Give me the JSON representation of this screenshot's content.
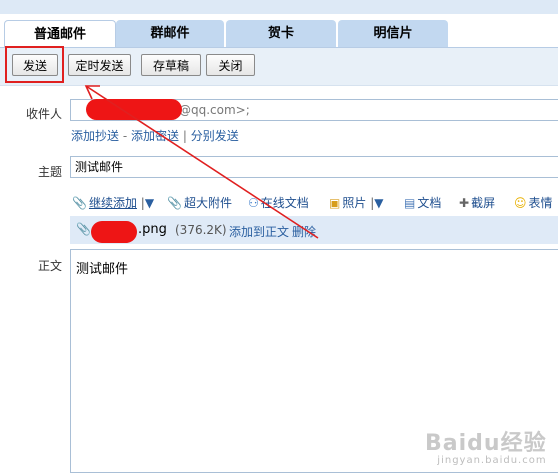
{
  "tabs": [
    "普通邮件",
    "群邮件",
    "贺卡",
    "明信片"
  ],
  "toolbar": {
    "send": "发送",
    "scheduled_send": "定时发送",
    "save_draft": "存草稿",
    "close": "关闭"
  },
  "recipient": {
    "label": "收件人",
    "value_suffix": "@qq.com>;",
    "actions": [
      "添加抄送",
      "-",
      "添加密送",
      "|",
      "分别发送"
    ]
  },
  "subject": {
    "label": "主题",
    "value": "测试邮件"
  },
  "attach_toolbar": {
    "items": [
      {
        "icon": "paperclip-icon",
        "label": "继续添加",
        "dropdown": true
      },
      {
        "icon": "paperclip-icon",
        "label": "超大附件"
      },
      {
        "icon": "online-doc-icon",
        "label": "在线文档"
      },
      {
        "icon": "photo-icon",
        "label": "照片",
        "dropdown": true
      },
      {
        "icon": "document-icon",
        "label": "文档"
      },
      {
        "icon": "screenshot-icon",
        "label": "截屏"
      },
      {
        "icon": "emoji-icon",
        "label": "表情"
      }
    ]
  },
  "attachment": {
    "ext": ".png",
    "size": "(376.2K)",
    "add_to_body": "添加到正文",
    "delete": "删除"
  },
  "body": {
    "label": "正文",
    "text": "测试邮件"
  },
  "watermark": {
    "text": "Baidu经验",
    "sub": "jingyan.baidu.com"
  },
  "colors": {
    "accent_red": "#e02020",
    "link_blue": "#2a5fa0",
    "tab_bg": "#c2d8f0"
  }
}
